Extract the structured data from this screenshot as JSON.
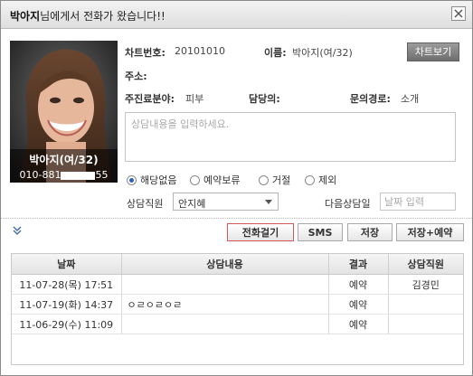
{
  "window": {
    "title_name": "박아지",
    "title_rest": "님에게서 전화가 왔습니다!!"
  },
  "photo": {
    "name": "박아지(여/32)",
    "phone_prefix": "010-881",
    "phone_suffix": "55"
  },
  "info": {
    "chart_no_label": "차트번호:",
    "chart_no_value": "20101010",
    "name_label": "이름:",
    "name_value": "박아지(여/32)",
    "chart_view_button": "차트보기",
    "address_label": "주소:",
    "address_value": "",
    "main_field_label": "주진료분야:",
    "main_field_value": "피부",
    "manager_label": "담당의:",
    "manager_value": "",
    "inquiry_label": "문의경로:",
    "inquiry_value": "소개"
  },
  "memo": {
    "placeholder": "상담내용을 입력하세요."
  },
  "status_options": [
    {
      "label": "해당없음",
      "selected": true
    },
    {
      "label": "예약보류",
      "selected": false
    },
    {
      "label": "거절",
      "selected": false
    },
    {
      "label": "제외",
      "selected": false
    }
  ],
  "staff": {
    "label": "상담직원",
    "selected": "안지혜"
  },
  "next_date": {
    "label": "다음상담일",
    "placeholder": "날짜 입력"
  },
  "actions": {
    "call": "전화걸기",
    "sms": "SMS",
    "save": "저장",
    "save_reserve": "저장+예약"
  },
  "history": {
    "columns": [
      "날짜",
      "상담내용",
      "결과",
      "상담직원"
    ],
    "rows": [
      {
        "date": "11-07-28(목) 17:51",
        "content": "",
        "result": "예약",
        "staff": "김경민"
      },
      {
        "date": "11-07-19(화) 14:37",
        "content": "ㅇㄹㅇㄹㅇㄹ",
        "result": "예약",
        "staff": ""
      },
      {
        "date": "11-06-29(수) 11:09",
        "content": "",
        "result": "예약",
        "staff": ""
      }
    ]
  },
  "colors": {
    "accent_radio": "#2b62b8",
    "call_button_border": "#d35858",
    "chart_button_bg": "#7a7a7a"
  }
}
